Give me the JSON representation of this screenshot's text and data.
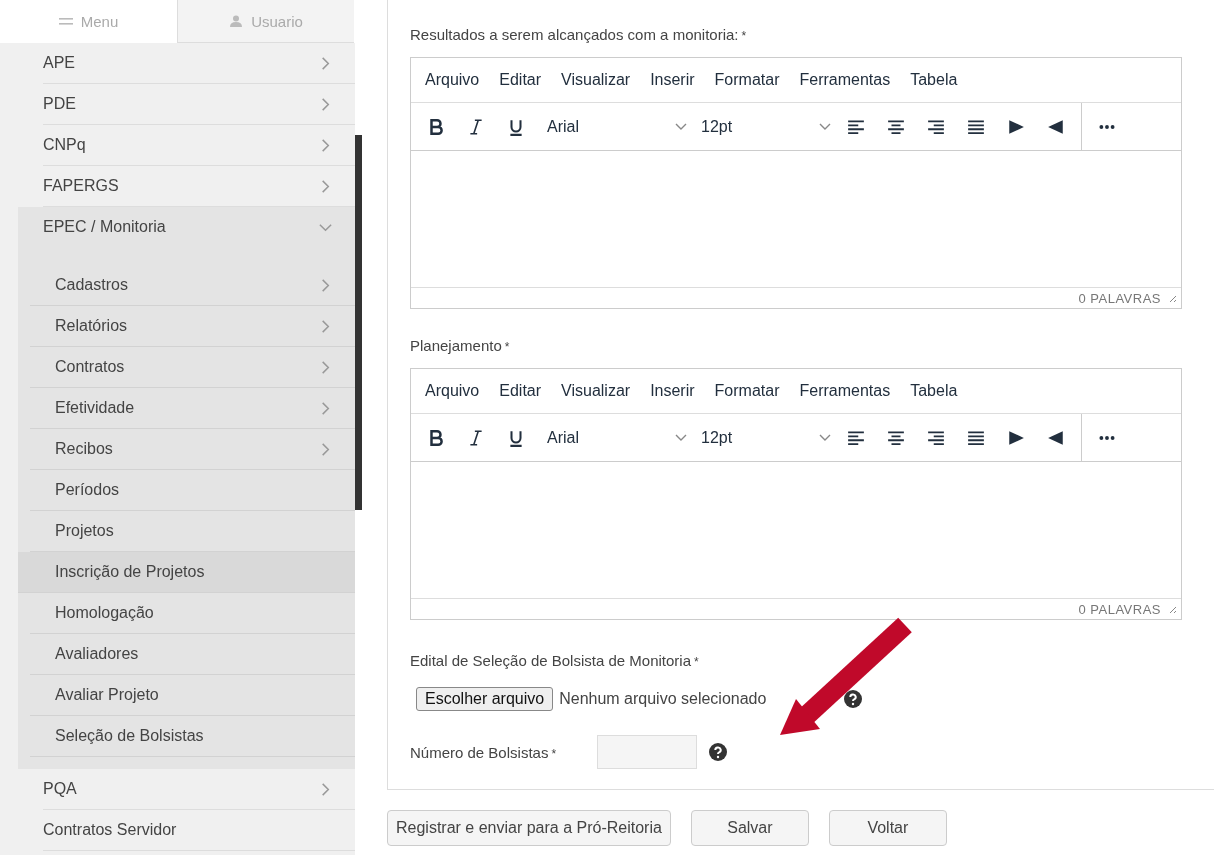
{
  "sidebar": {
    "tabs": [
      {
        "label": "Menu",
        "selected": true
      },
      {
        "label": "Usuario",
        "selected": false
      }
    ],
    "items": [
      {
        "label": "APE",
        "kind": "group",
        "expanded": false
      },
      {
        "label": "PDE",
        "kind": "group",
        "expanded": false
      },
      {
        "label": "CNPq",
        "kind": "group",
        "expanded": false
      },
      {
        "label": "FAPERGS",
        "kind": "group",
        "expanded": false
      },
      {
        "label": "EPEC / Monitoria",
        "kind": "group",
        "expanded": true,
        "children": [
          {
            "label": "Cadastros",
            "kind": "group",
            "selected": false
          },
          {
            "label": "Relatórios",
            "kind": "group",
            "selected": false
          },
          {
            "label": "Contratos",
            "kind": "group",
            "selected": false
          },
          {
            "label": "Efetividade",
            "kind": "group",
            "selected": false
          },
          {
            "label": "Recibos",
            "kind": "group",
            "selected": false
          },
          {
            "label": "Períodos",
            "kind": "link",
            "selected": false
          },
          {
            "label": "Projetos",
            "kind": "link",
            "selected": false
          },
          {
            "label": "Inscrição de Projetos",
            "kind": "link",
            "selected": true
          },
          {
            "label": "Homologação",
            "kind": "link",
            "selected": false
          },
          {
            "label": "Avaliadores",
            "kind": "link",
            "selected": false
          },
          {
            "label": "Avaliar Projeto",
            "kind": "link",
            "selected": false
          },
          {
            "label": "Seleção de Bolsistas",
            "kind": "link",
            "selected": false
          }
        ]
      },
      {
        "label": "PQA",
        "kind": "group",
        "expanded": false
      },
      {
        "label": "Contratos Servidor",
        "kind": "link",
        "expanded": false
      }
    ]
  },
  "editors": [
    {
      "label": "Resultados a serem alcançados com a monitoria:",
      "required": "*",
      "menu": [
        "Arquivo",
        "Editar",
        "Visualizar",
        "Inserir",
        "Formatar",
        "Ferramentas",
        "Tabela"
      ],
      "font": "Arial",
      "size": "12pt",
      "word_count": "0 PALAVRAS"
    },
    {
      "label": "Planejamento",
      "required": "*",
      "menu": [
        "Arquivo",
        "Editar",
        "Visualizar",
        "Inserir",
        "Formatar",
        "Ferramentas",
        "Tabela"
      ],
      "font": "Arial",
      "size": "12pt",
      "word_count": "0 PALAVRAS"
    }
  ],
  "file_field": {
    "label": "Edital de Seleção de Bolsista de Monitoria",
    "required": "*",
    "button": "Escolher arquivo",
    "status": "Nenhum arquivo selecionado"
  },
  "number_field": {
    "label": "Número de Bolsistas",
    "required": "*"
  },
  "buttons": [
    "Registrar e enviar para a Pró-Reitoria",
    "Salvar",
    "Voltar"
  ]
}
